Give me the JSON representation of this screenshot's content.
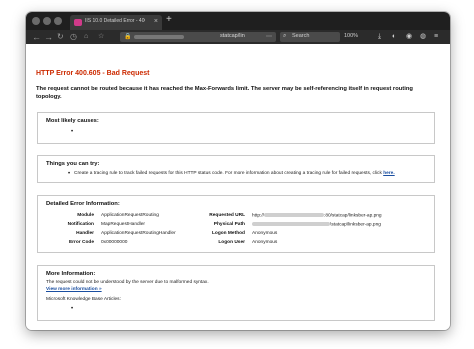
{
  "browser": {
    "tab_title": "IIS 10.0 Detailed Error - 400.605 - Bad Request",
    "tab_close": "×",
    "new_tab": "+",
    "url_text": "statcap/lin",
    "search_placeholder": "Search",
    "zoom_level": "100%"
  },
  "error": {
    "title": "HTTP Error 400.605 - Bad Request",
    "description": "The request cannot be routed because it has reached the Max-Forwards limit. The server may be self-referencing itself in request routing topology."
  },
  "causes": {
    "heading": "Most likely causes:",
    "items": [
      "•"
    ]
  },
  "try": {
    "heading": "Things you can try:",
    "text": "Create a tracing rule to track failed requests for this HTTP status code. For more information about creating a tracing rule for failed requests, click",
    "link": "here."
  },
  "details": {
    "heading": "Detailed Error Information:",
    "left": [
      {
        "label": "Module",
        "value": "ApplicationRequestRouting"
      },
      {
        "label": "Notification",
        "value": "MapRequestHandler"
      },
      {
        "label": "Handler",
        "value": "ApplicationRequestRoutingHandler"
      },
      {
        "label": "Error Code",
        "value": "0x00000000"
      }
    ],
    "right": [
      {
        "label": "Requested URL",
        "value_prefix": "http://",
        "value_suffix": ":80/statcap/linksber-ap.png"
      },
      {
        "label": "Physical Path",
        "value_prefix": "",
        "value_suffix": "\\statcap\\linksber-ap.png"
      },
      {
        "label": "Logon Method",
        "value": "Anonymous"
      },
      {
        "label": "Logon User",
        "value": "Anonymous"
      }
    ]
  },
  "more": {
    "heading": "More Information:",
    "text": "The request could not be understood by the server due to malformed syntax.",
    "link": "View more information »",
    "kb": "Microsoft Knowledge Base Articles:",
    "bullet": "•"
  },
  "colors": {
    "error_red": "#cc2a00",
    "link_blue": "#1a4ea0",
    "tab_icon": "#d13a8a"
  },
  "icons": [
    "back-icon",
    "forward-icon",
    "reload-icon",
    "history-icon",
    "lock-icon",
    "search-icon",
    "menu-icon",
    "extension-icon"
  ]
}
